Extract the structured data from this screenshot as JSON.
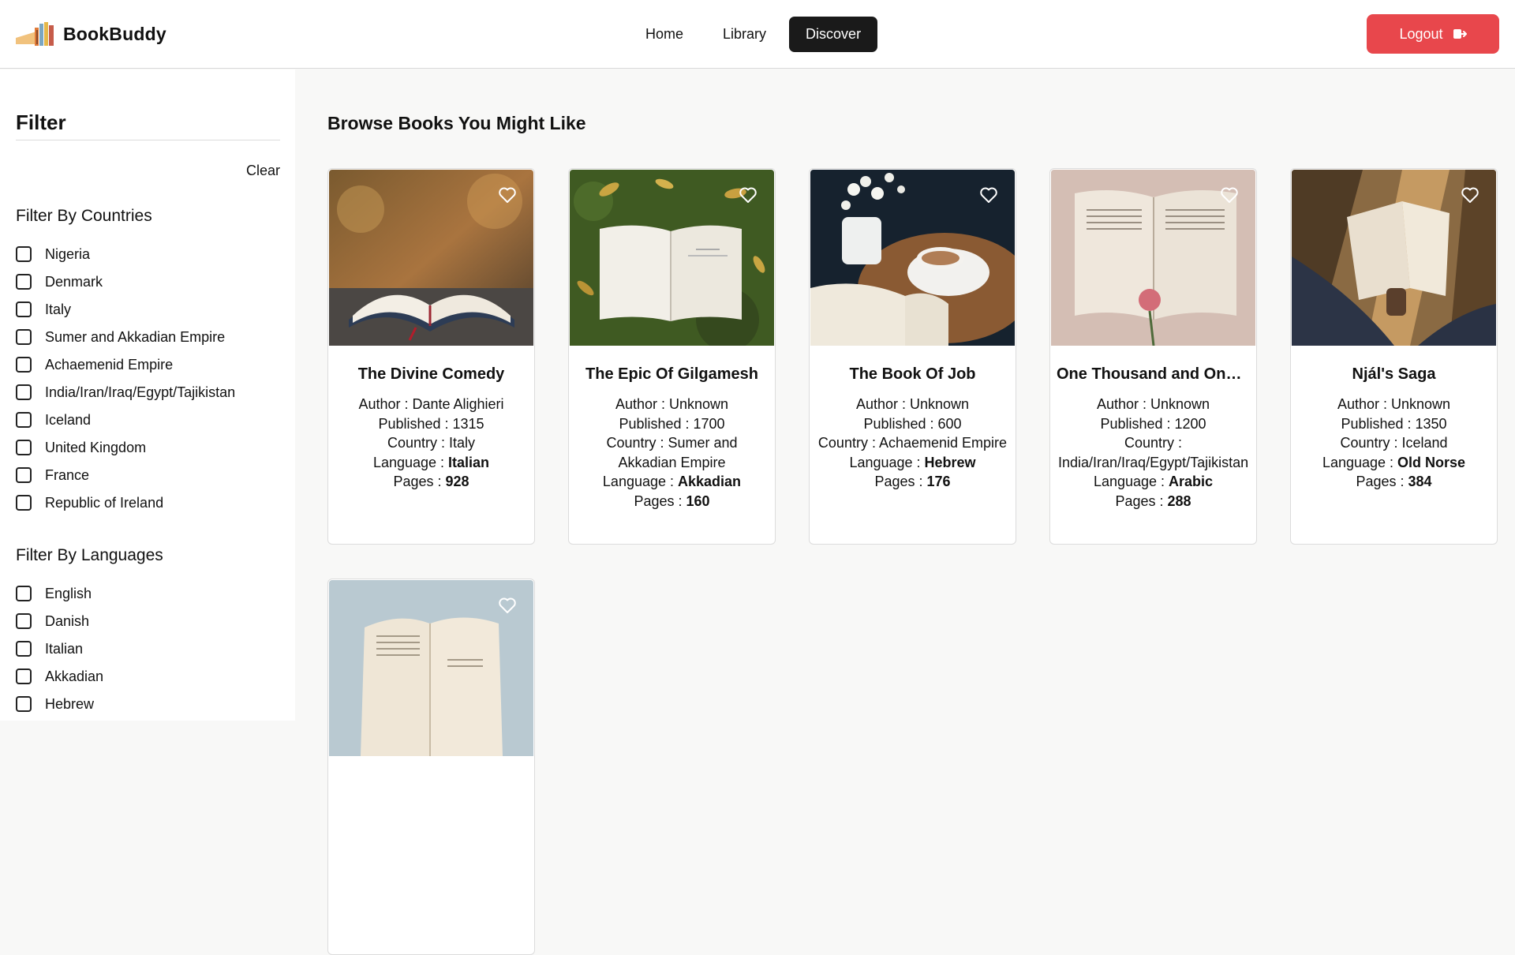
{
  "header": {
    "brand": "BookBuddy",
    "nav": [
      {
        "label": "Home",
        "active": false
      },
      {
        "label": "Library",
        "active": false
      },
      {
        "label": "Discover",
        "active": true
      }
    ],
    "logout_label": "Logout",
    "logout_color": "#e8474c"
  },
  "sidebar": {
    "title": "Filter",
    "clear_label": "Clear",
    "countries_title": "Filter By Countries",
    "countries": [
      "Nigeria",
      "Denmark",
      "Italy",
      "Sumer and Akkadian Empire",
      "Achaemenid Empire",
      "India/Iran/Iraq/Egypt/Tajikistan",
      "Iceland",
      "United Kingdom",
      "France",
      "Republic of Ireland"
    ],
    "languages_title": "Filter By Languages",
    "languages": [
      "English",
      "Danish",
      "Italian",
      "Akkadian",
      "Hebrew"
    ]
  },
  "main": {
    "title": "Browse Books You Might Like",
    "labels": {
      "author": "Author : ",
      "published": "Published : ",
      "country": "Country : ",
      "language": "Language : ",
      "pages": "Pages : "
    },
    "books": [
      {
        "title": "The Divine Comedy",
        "author": "Dante Alighieri",
        "published": "1315",
        "country": "Italy",
        "language": "Italian",
        "pages": "928",
        "image": "open-book-on-rock-photo"
      },
      {
        "title": "The Epic Of Gilgamesh",
        "author": "Unknown",
        "published": "1700",
        "country": "Sumer and Akkadian Empire",
        "language": "Akkadian",
        "pages": "160",
        "image": "open-book-on-grass-photo"
      },
      {
        "title": "The Book Of Job",
        "author": "Unknown",
        "published": "600",
        "country": "Achaemenid Empire",
        "language": "Hebrew",
        "pages": "176",
        "image": "book-with-coffee-photo"
      },
      {
        "title": "One Thousand and One Nights",
        "author": "Unknown",
        "published": "1200",
        "country": "India/Iran/Iraq/Egypt/Tajikistan",
        "language": "Arabic",
        "pages": "288",
        "image": "book-with-rose-photo"
      },
      {
        "title": "Njál's Saga",
        "author": "Unknown",
        "published": "1350",
        "country": "Iceland",
        "language": "Old Norse",
        "pages": "384",
        "image": "reading-in-sunlight-photo"
      },
      {
        "title": "",
        "author": "",
        "published": "",
        "country": "",
        "language": "",
        "pages": "",
        "image": "open-book-blue-photo"
      }
    ]
  }
}
